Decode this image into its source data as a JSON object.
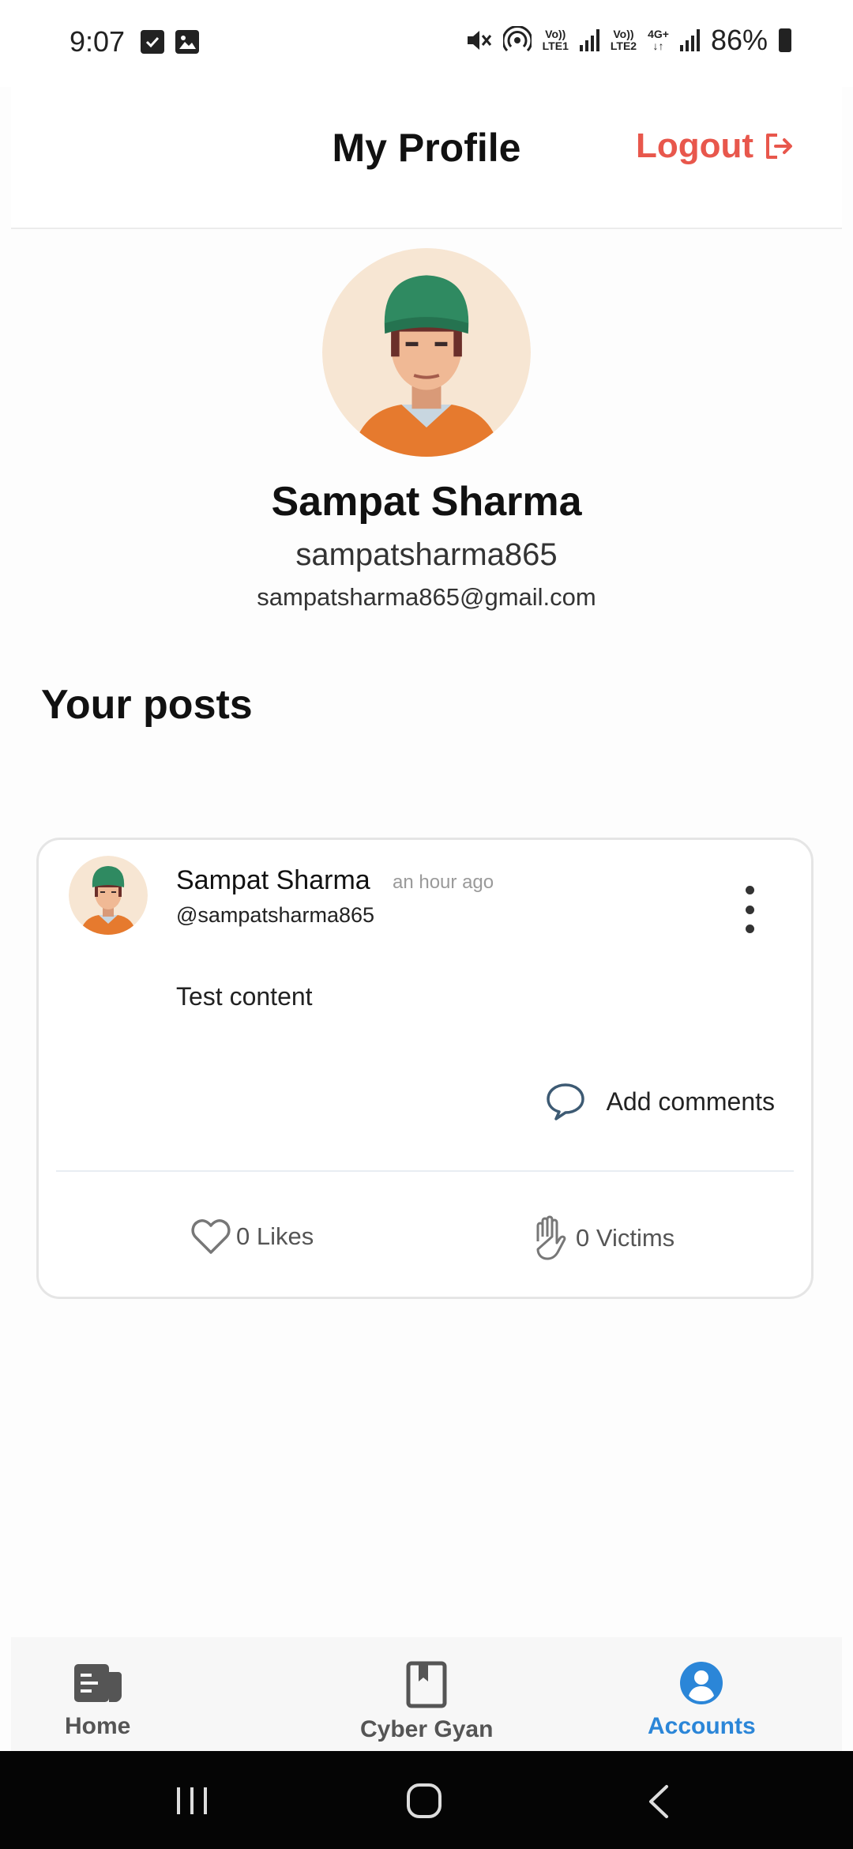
{
  "status_bar": {
    "time": "9:07",
    "icons": [
      "checkbox-notification-icon",
      "image-notification-icon",
      "mute-icon",
      "hotspot-icon",
      "signal-icon",
      "battery-icon"
    ],
    "sim1_top": "Vo))",
    "sim1_bottom": "LTE1",
    "sim2_top": "Vo))",
    "sim2_bottom": "LTE2",
    "net_type": "4G+",
    "battery": "86%"
  },
  "header": {
    "title": "My Profile",
    "logout_label": "Logout"
  },
  "profile": {
    "name": "Sampat Sharma",
    "username": "sampatsharma865",
    "email": "sampatsharma865@gmail.com"
  },
  "posts_section": {
    "title": "Your posts"
  },
  "post": {
    "author": "Sampat Sharma",
    "time": "an hour ago",
    "handle": "@sampatsharma865",
    "content": "Test content",
    "comment_label": "Add comments",
    "likes_label": "0 Likes",
    "victims_label": "0 Victims"
  },
  "bottom_nav": {
    "items": [
      {
        "label": "Home",
        "icon": "home-news-icon",
        "active": false
      },
      {
        "label": "Cyber Gyan",
        "icon": "book-icon",
        "active": false
      },
      {
        "label": "Accounts",
        "icon": "account-icon",
        "active": true
      }
    ]
  },
  "colors": {
    "accent": "#2b86d8",
    "logout": "#e8574c",
    "avatar_bg": "#f7e6d3",
    "beanie": "#2f8a61",
    "jacket": "#e67a2e"
  }
}
